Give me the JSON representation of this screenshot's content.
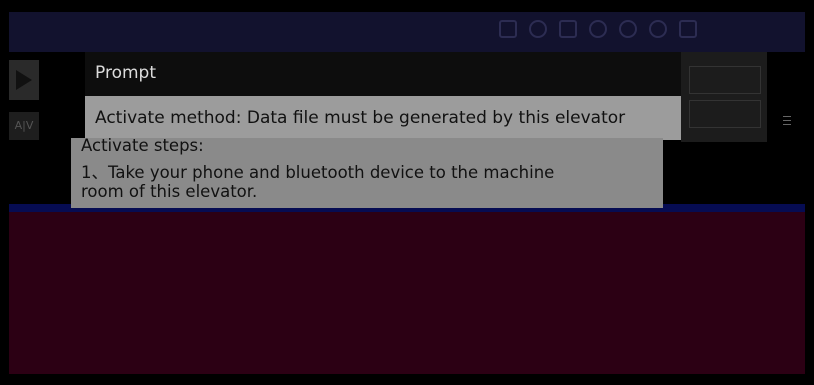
{
  "dialog": {
    "title": "Prompt",
    "method": "Activate method: Data file must be generated by this elevator",
    "steps_heading": "Activate steps:",
    "step1": "1、Take your phone and bluetooth device to the machine",
    "step1_cont": "room of this elevator."
  },
  "colors": {
    "dialog_header": "#0d0d0d",
    "dialog_body": "#8a8a8a",
    "lower_region": "#2c0014"
  }
}
